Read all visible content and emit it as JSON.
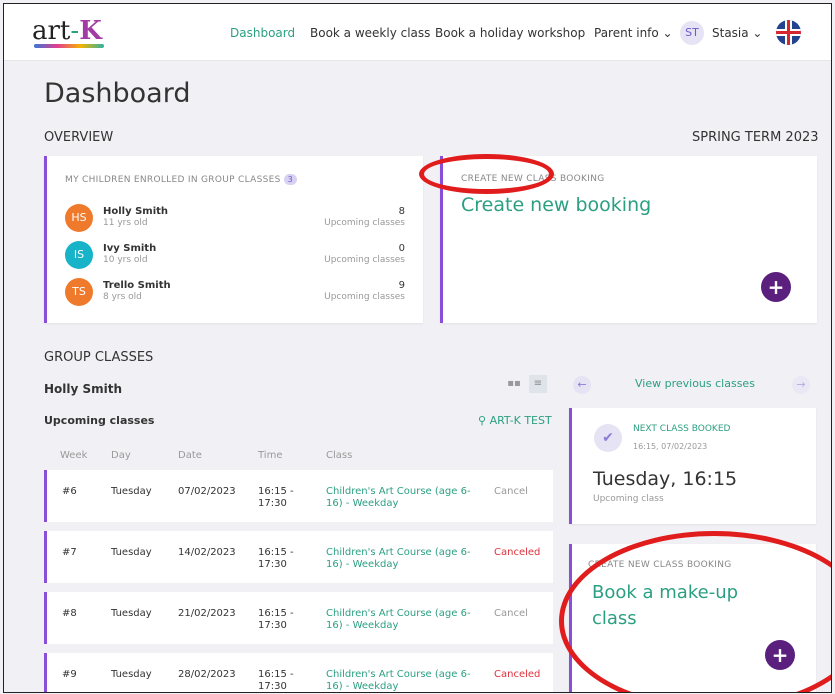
{
  "nav": {
    "logo_text": "art",
    "logo_k": "K",
    "links": [
      "Dashboard",
      "Book a weekly class",
      "Book a holiday workshop",
      "Parent info ⌄"
    ],
    "user_initials": "ST",
    "user_name": "Stasia ⌄"
  },
  "page_title": "Dashboard",
  "overview": {
    "label": "OVERVIEW",
    "term": "SPRING TERM 2023"
  },
  "enrolled_card": {
    "title": "MY CHILDREN ENROLLED IN GROUP CLASSES",
    "badge": "3",
    "children": [
      {
        "initials": "HS",
        "name": "Holly Smith",
        "age": "11 yrs old",
        "count": "8",
        "count_label": "Upcoming classes",
        "color": "#f07a2b"
      },
      {
        "initials": "IS",
        "name": "Ivy Smith",
        "age": "10 yrs old",
        "count": "0",
        "count_label": "Upcoming classes",
        "color": "#17b3c9"
      },
      {
        "initials": "TS",
        "name": "Trello Smith",
        "age": "8 yrs old",
        "count": "9",
        "count_label": "Upcoming classes",
        "color": "#f07a2b"
      }
    ]
  },
  "create_card": {
    "label": "CREATE NEW CLASS BOOKING",
    "title": "Create new booking",
    "button": "+"
  },
  "group_classes": {
    "label": "GROUP CLASSES",
    "child_name": "Holly Smith",
    "upcoming_label": "Upcoming classes",
    "location": "ART-K TEST",
    "columns": [
      "Week",
      "Day",
      "Date",
      "Time",
      "Class"
    ],
    "rows": [
      {
        "week": "#6",
        "day": "Tuesday",
        "date": "07/02/2023",
        "time1": "16:15 -",
        "time2": "17:30",
        "class1": "Children's Art Course (age 6-",
        "class2": "16) - Weekday",
        "status": "Cancel",
        "status_type": "cancel"
      },
      {
        "week": "#7",
        "day": "Tuesday",
        "date": "14/02/2023",
        "time1": "16:15 -",
        "time2": "17:30",
        "class1": "Children's Art Course (age 6-",
        "class2": "16) - Weekday",
        "status": "Canceled",
        "status_type": "canceled"
      },
      {
        "week": "#8",
        "day": "Tuesday",
        "date": "21/02/2023",
        "time1": "16:15 -",
        "time2": "17:30",
        "class1": "Children's Art Course (age 6-",
        "class2": "16) - Weekday",
        "status": "Cancel",
        "status_type": "cancel"
      },
      {
        "week": "#9",
        "day": "Tuesday",
        "date": "28/02/2023",
        "time1": "16:15 -",
        "time2": "17:30",
        "class1": "Children's Art Course (age 6-",
        "class2": "16) - Weekday",
        "status": "Canceled",
        "status_type": "canceled"
      }
    ]
  },
  "side": {
    "view_previous": "View previous classes",
    "next_label": "NEXT CLASS BOOKED",
    "next_date": "16:15, 07/02/2023",
    "next_title": "Tuesday, 16:15",
    "next_sub": "Upcoming class",
    "makeup_label": "CREATE NEW CLASS BOOKING",
    "makeup_title1": "Book a make-up",
    "makeup_title2": "class",
    "button": "+"
  },
  "colors": {
    "accent_purple": "#8a4fd8",
    "button_purple": "#5b1f7d",
    "green": "#2b9f82",
    "red": "#e0303c"
  }
}
